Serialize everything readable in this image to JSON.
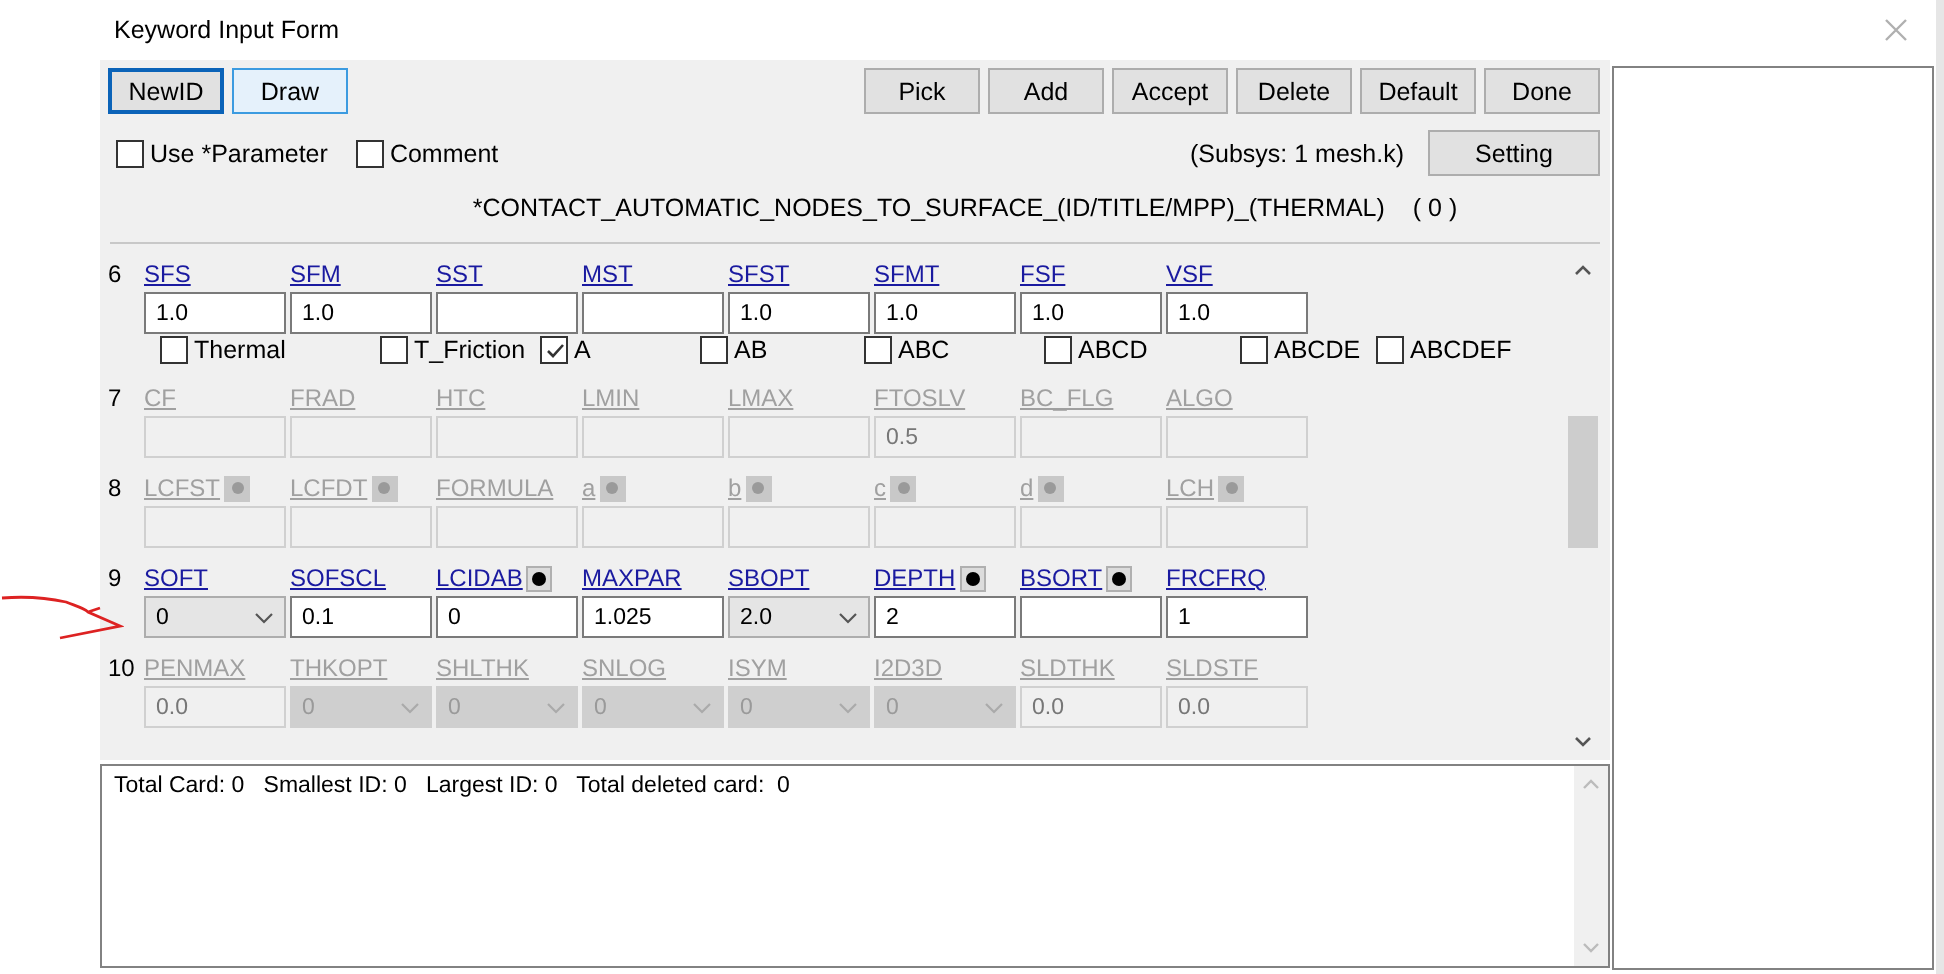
{
  "window": {
    "title": "Keyword Input Form"
  },
  "toolbar_left": [
    {
      "label": "NewID",
      "focused": true,
      "highlighted": false
    },
    {
      "label": "Draw",
      "focused": false,
      "highlighted": true
    }
  ],
  "toolbar_right": [
    {
      "label": "Pick",
      "focused": false,
      "highlighted": false
    },
    {
      "label": "Add",
      "focused": false,
      "highlighted": false
    },
    {
      "label": "Accept",
      "focused": false,
      "highlighted": false
    },
    {
      "label": "Delete",
      "focused": false,
      "highlighted": false
    },
    {
      "label": "Default",
      "focused": false,
      "highlighted": false
    },
    {
      "label": "Done",
      "focused": false,
      "highlighted": false
    }
  ],
  "options": [
    {
      "label": "Use *Parameter",
      "checked": false
    },
    {
      "label": "Comment",
      "checked": false
    }
  ],
  "subsys": "(Subsys: 1 mesh.k)",
  "setting_button": "Setting",
  "keyword": "*CONTACT_AUTOMATIC_NODES_TO_SURFACE_(ID/TITLE/MPP)_(THERMAL)",
  "keyword_count": "( 0 )",
  "cards": [
    {
      "number": "6",
      "disabled": false,
      "fields": [
        {
          "label": "SFS",
          "kind": "text",
          "value": "1.0"
        },
        {
          "label": "SFM",
          "kind": "text",
          "value": "1.0"
        },
        {
          "label": "SST",
          "kind": "text"
        },
        {
          "label": "MST",
          "kind": "text"
        },
        {
          "label": "SFST",
          "kind": "text",
          "value": "1.0"
        },
        {
          "label": "SFMT",
          "kind": "text",
          "value": "1.0"
        },
        {
          "label": "FSF",
          "kind": "text",
          "value": "1.0"
        },
        {
          "label": "VSF",
          "kind": "text",
          "value": "1.0"
        }
      ],
      "checkboxes": [
        {
          "label": "Thermal",
          "checked": false
        },
        {
          "label": "T_Friction",
          "checked": false
        },
        {
          "label": "A",
          "checked": true
        },
        {
          "label": "AB",
          "checked": false
        },
        {
          "label": "ABC",
          "checked": false
        },
        {
          "label": "ABCD",
          "checked": false
        },
        {
          "label": "ABCDE",
          "checked": false
        },
        {
          "label": "ABCDEF",
          "checked": false
        }
      ]
    },
    {
      "number": "7",
      "disabled": true,
      "fields": [
        {
          "label": "CF",
          "kind": "text"
        },
        {
          "label": "FRAD",
          "kind": "text"
        },
        {
          "label": "HTC",
          "kind": "text"
        },
        {
          "label": "LMIN",
          "kind": "text"
        },
        {
          "label": "LMAX",
          "kind": "text"
        },
        {
          "label": "FTOSLV",
          "kind": "text",
          "value": "0.5"
        },
        {
          "label": "BC_FLG",
          "kind": "text"
        },
        {
          "label": "ALGO",
          "kind": "text"
        }
      ]
    },
    {
      "number": "8",
      "disabled": true,
      "fields": [
        {
          "label": "LCFST",
          "kind": "text",
          "pick": true
        },
        {
          "label": "LCFDT",
          "kind": "text",
          "pick": true
        },
        {
          "label": "FORMULA",
          "kind": "text"
        },
        {
          "label": "a",
          "kind": "text",
          "pick": true
        },
        {
          "label": "b",
          "kind": "text",
          "pick": true
        },
        {
          "label": "c",
          "kind": "text",
          "pick": true
        },
        {
          "label": "d",
          "kind": "text",
          "pick": true
        },
        {
          "label": "LCH",
          "kind": "text",
          "pick": true
        }
      ]
    },
    {
      "number": "9",
      "disabled": false,
      "fields": [
        {
          "label": "SOFT",
          "kind": "select",
          "value": "0"
        },
        {
          "label": "SOFSCL",
          "kind": "text",
          "value": "0.1"
        },
        {
          "label": "LCIDAB",
          "kind": "text",
          "value": "0",
          "pick": true
        },
        {
          "label": "MAXPAR",
          "kind": "text",
          "value": "1.025"
        },
        {
          "label": "SBOPT",
          "kind": "select",
          "value": "2.0"
        },
        {
          "label": "DEPTH",
          "kind": "text",
          "value": "2",
          "pick": true
        },
        {
          "label": "BSORT",
          "kind": "text",
          "pick": true
        },
        {
          "label": "FRCFRQ",
          "kind": "text",
          "value": "1"
        }
      ]
    },
    {
      "number": "10",
      "disabled": true,
      "fields": [
        {
          "label": "PENMAX",
          "kind": "text",
          "value": "0.0"
        },
        {
          "label": "THKOPT",
          "kind": "select",
          "value": "0"
        },
        {
          "label": "SHLTHK",
          "kind": "select",
          "value": "0"
        },
        {
          "label": "SNLOG",
          "kind": "select",
          "value": "0"
        },
        {
          "label": "ISYM",
          "kind": "select",
          "value": "0"
        },
        {
          "label": "I2D3D",
          "kind": "select",
          "value": "0"
        },
        {
          "label": "SLDTHK",
          "kind": "text",
          "value": "0.0"
        },
        {
          "label": "SLDSTF",
          "kind": "text",
          "value": "0.0"
        }
      ]
    }
  ],
  "message": "Total Card: 0   Smallest ID: 0   Largest ID: 0   Total deleted card:  0"
}
